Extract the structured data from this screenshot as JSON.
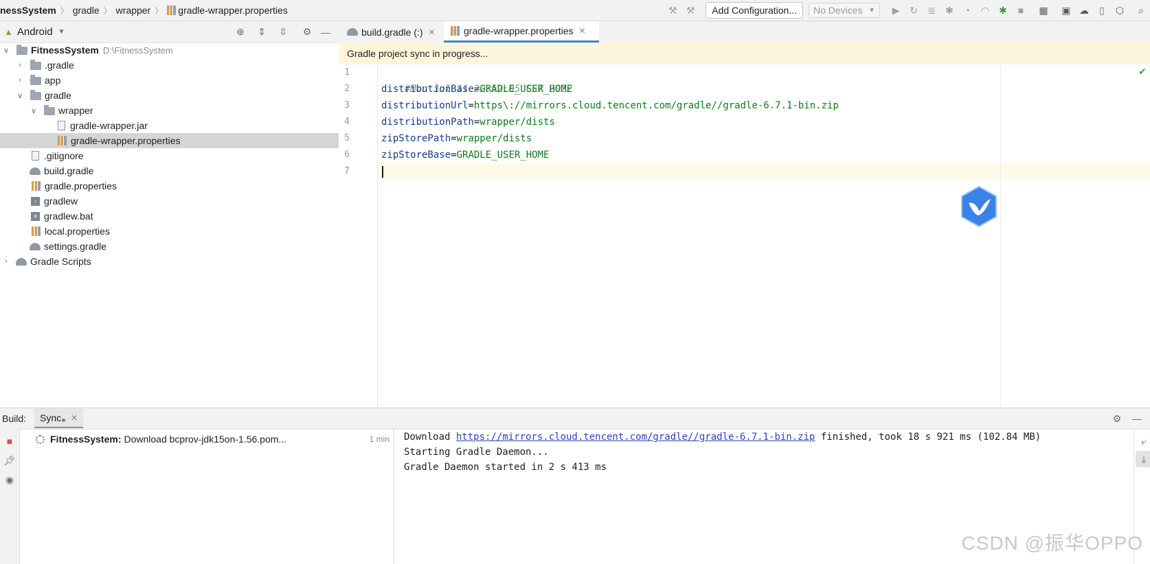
{
  "breadcrumb": {
    "project": "nessSystem",
    "items": [
      "gradle",
      "wrapper",
      "gradle-wrapper.properties"
    ]
  },
  "toolbar": {
    "add_configuration": "Add Configuration...",
    "device_select": "No Devices"
  },
  "project_panel": {
    "view": "Android",
    "tree": [
      {
        "label": "FitnessSystem",
        "hint": "D:\\FitnessSystem"
      },
      {
        "label": ".gradle"
      },
      {
        "label": "app"
      },
      {
        "label": "gradle"
      },
      {
        "label": "wrapper"
      },
      {
        "label": "gradle-wrapper.jar"
      },
      {
        "label": "gradle-wrapper.properties"
      },
      {
        "label": ".gitignore"
      },
      {
        "label": "build.gradle"
      },
      {
        "label": "gradle.properties"
      },
      {
        "label": "gradlew"
      },
      {
        "label": "gradlew.bat"
      },
      {
        "label": "local.properties"
      },
      {
        "label": "settings.gradle"
      },
      {
        "label": "Gradle Scripts"
      }
    ]
  },
  "editor": {
    "tabs": [
      {
        "label": "build.gradle (:)"
      },
      {
        "label": "gradle-wrapper.properties"
      }
    ],
    "banner": "Gradle project sync in progress...",
    "line_numbers": [
      "1",
      "2",
      "3",
      "4",
      "5",
      "6",
      "7"
    ],
    "lines": [
      {
        "comment": "#Mon Jul 11 22:52:05 CST 2022"
      },
      {
        "key": "distributionBase",
        "sep": "=",
        "value": "GRADLE_USER_HOME"
      },
      {
        "key": "distributionUrl",
        "sep": "=",
        "value": "https\\://mirrors.cloud.tencent.com/gradle//gradle-6.7.1-bin.zip"
      },
      {
        "key": "distributionPath",
        "sep": "=",
        "value": "wrapper/dists"
      },
      {
        "key": "zipStorePath",
        "sep": "=",
        "value": "wrapper/dists"
      },
      {
        "key": "zipStoreBase",
        "sep": "=",
        "value": "GRADLE_USER_HOME"
      }
    ]
  },
  "build": {
    "label": "Build:",
    "tab": "Sync",
    "task": {
      "name": "FitnessSystem:",
      "message": "Download bcprov-jdk15on-1.56.pom...",
      "time": "1 min"
    },
    "console": {
      "line1_prefix": "Download ",
      "line1_link": "https://mirrors.cloud.tencent.com/gradle//gradle-6.7.1-bin.zip",
      "line1_suffix": " finished, took 18 s 921 ms (102.84 MB)",
      "line2": "Starting Gradle Daemon...",
      "line3": "Gradle Daemon started in 2 s 413 ms"
    }
  },
  "watermark": "CSDN @振华OPPO",
  "colors": {
    "accent": "#4083c9",
    "banner": "#fdf6dc",
    "key": "#0f3f8a",
    "value": "#0d7a1a",
    "link": "#2c3fbf"
  }
}
